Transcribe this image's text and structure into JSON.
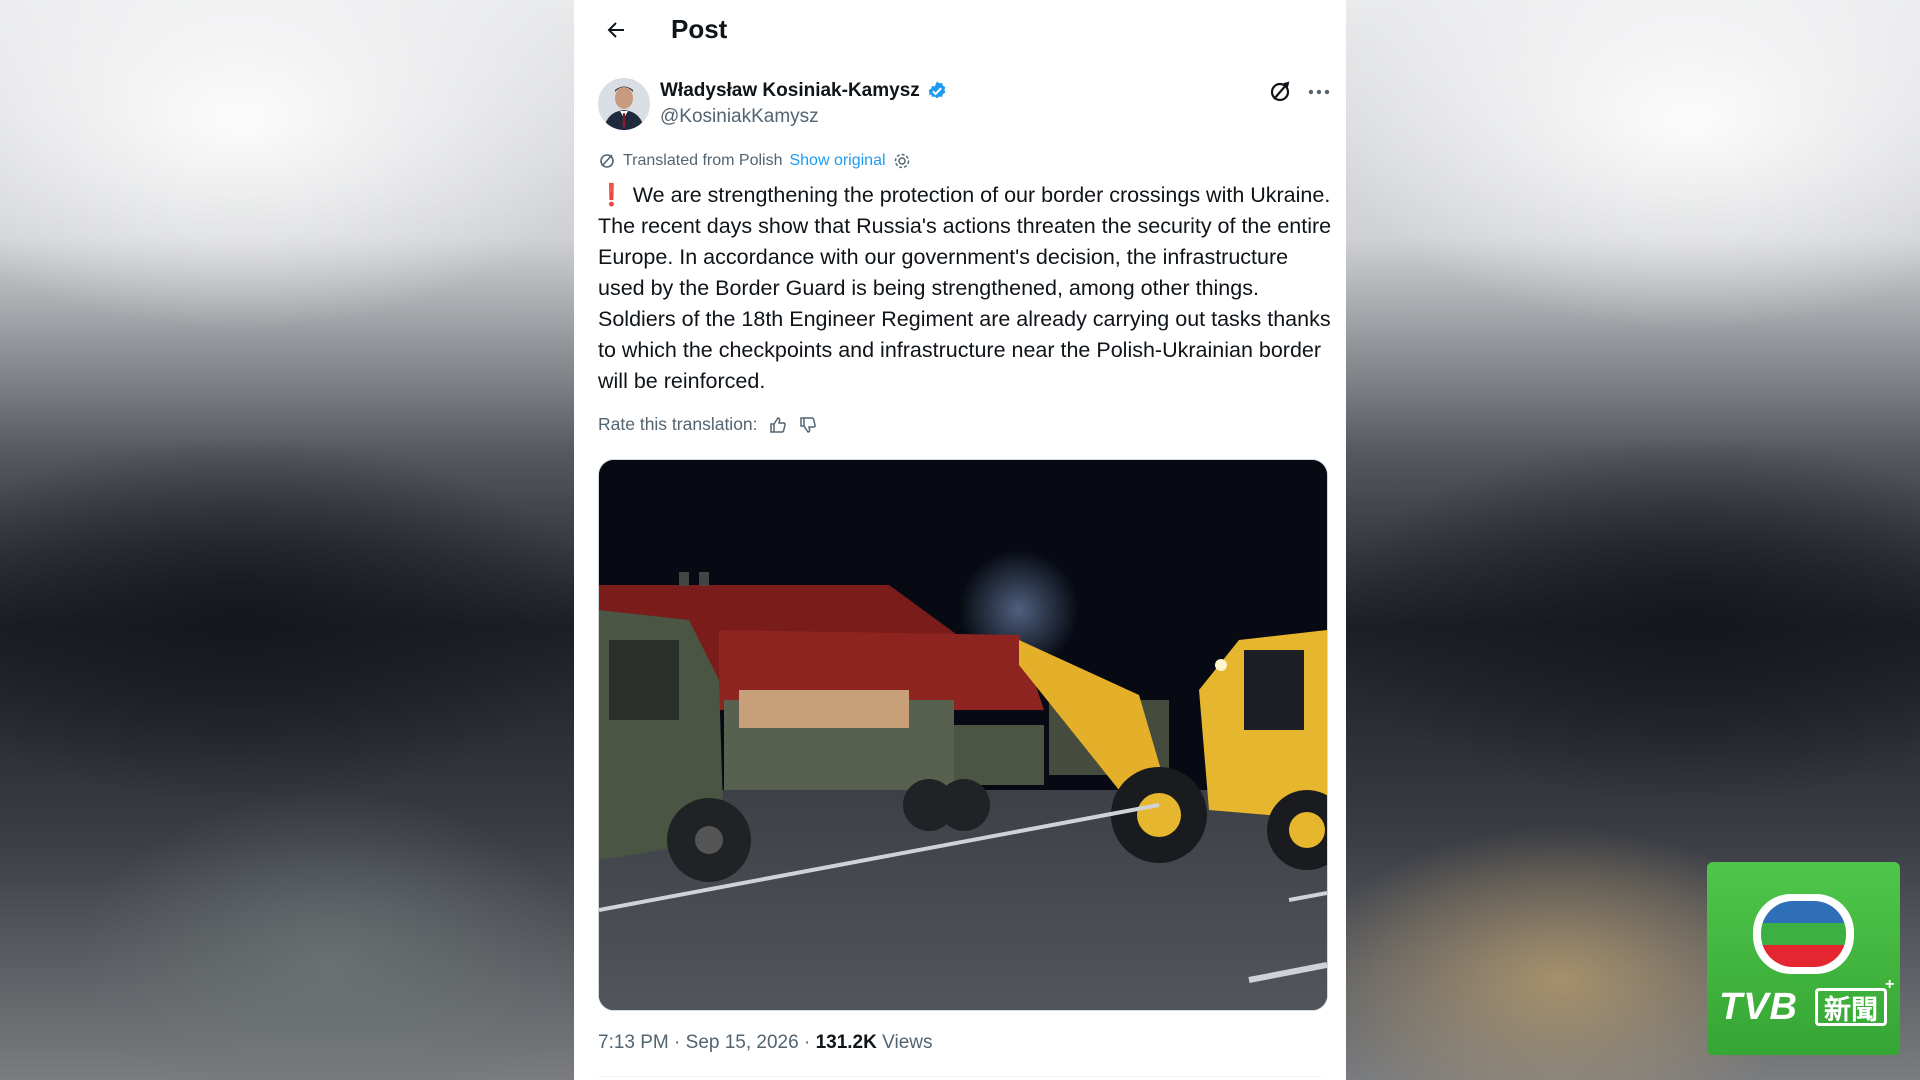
{
  "header": {
    "back_icon": "arrow-left-icon",
    "title": "Post"
  },
  "author": {
    "name": "Władysław Kosiniak-Kamysz",
    "handle": "@KosiniakKamysz",
    "verified": true,
    "verified_color": "#1d9bf0"
  },
  "translation": {
    "label": "Translated from Polish",
    "show_original": "Show original"
  },
  "tweet": {
    "exclamation": "❗",
    "text": "We are strengthening the protection of our border crossings with Ukraine. The recent days show that Russia's actions threaten the security of the entire Europe. In accordance with our government's decision, the infrastructure used by the Border Guard is being strengthened, among other things. Soldiers of the 18th Engineer Regiment are already carrying out tasks thanks to which the checkpoints and infrastructure near the Polish-Ukrainian border will be reinforced."
  },
  "rate": {
    "label": "Rate this translation:"
  },
  "meta": {
    "time_date": "7:13 PM · Sep 15, 2026 · ",
    "views_count": "131.2K",
    "views_label": " Views"
  },
  "overlay": {
    "brand": "TVB",
    "news": "新聞",
    "plus": "+",
    "brand_color": "#3fb83c"
  }
}
